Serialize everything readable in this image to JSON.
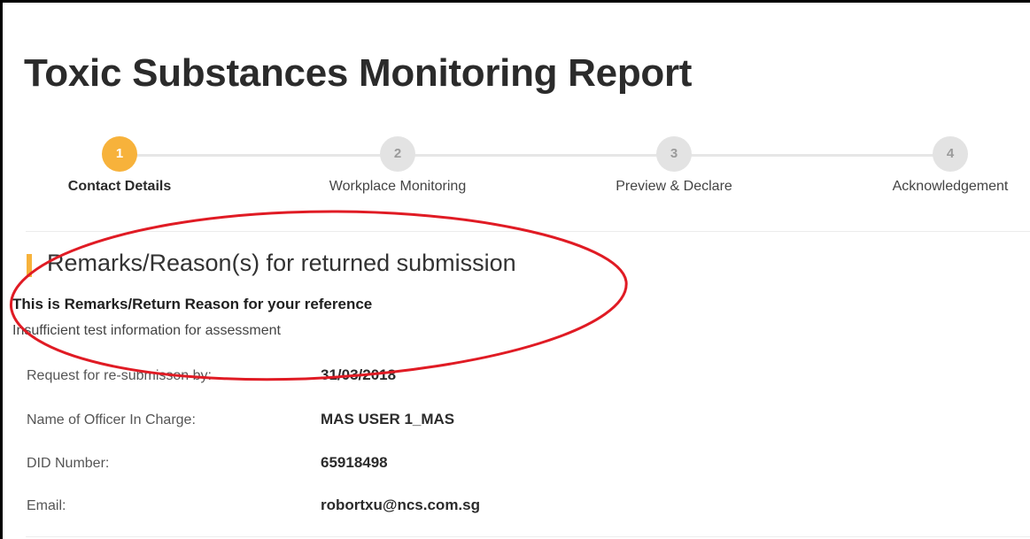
{
  "page": {
    "title": "Toxic Substances Monitoring Report"
  },
  "stepper": {
    "steps": [
      {
        "number": "1",
        "label": "Contact Details",
        "state": "active"
      },
      {
        "number": "2",
        "label": "Workplace Monitoring",
        "state": "inactive"
      },
      {
        "number": "3",
        "label": "Preview & Declare",
        "state": "inactive"
      },
      {
        "number": "4",
        "label": "Acknowledgement",
        "state": "inactive"
      }
    ]
  },
  "remarks": {
    "heading": "Remarks/Reason(s) for returned submission",
    "subtitle": "This is Remarks/Return Reason for your reference",
    "text": "Insufficient test information for assessment"
  },
  "details": [
    {
      "label": "Request for re-submisson by:",
      "value": "31/03/2018"
    },
    {
      "label": "Name of Officer In Charge:",
      "value": "MAS USER 1_MAS"
    },
    {
      "label": "DID Number:",
      "value": "65918498"
    },
    {
      "label": "Email:",
      "value": "robortxu@ncs.com.sg"
    }
  ],
  "colors": {
    "accent": "#f7b23b",
    "annotation": "#e01b24",
    "inactive_step": "#e3e3e3"
  }
}
